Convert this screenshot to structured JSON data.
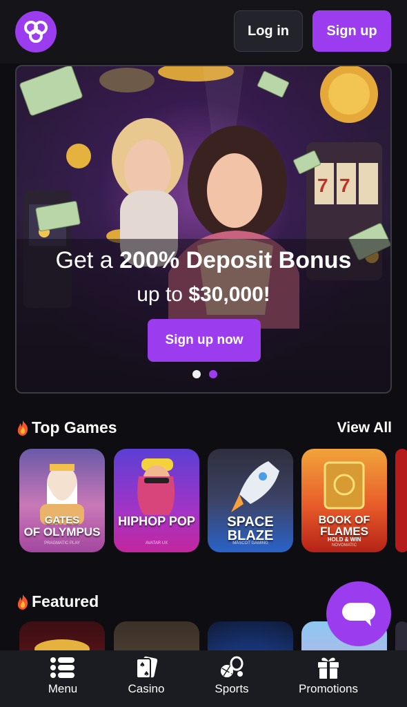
{
  "header": {
    "login_label": "Log in",
    "signup_label": "Sign up"
  },
  "hero": {
    "line1_prefix": "Get a ",
    "line1_bold": "200% Deposit Bonus",
    "line2_prefix": "up to ",
    "line2_bold": "$30,000!",
    "cta_label": "Sign up now",
    "slide_count": 2,
    "active_slide": 2
  },
  "top_games": {
    "title": "Top Games",
    "view_all_label": "View All",
    "games": [
      {
        "name": "GATES",
        "name2": "OF OLYMPUS",
        "provider": "PRAGMATIC PLAY"
      },
      {
        "name": "HIPHOP POP",
        "provider": "AVATAR UX"
      },
      {
        "name": "SPACE BLAZE",
        "provider": "MASCOT GAMING"
      },
      {
        "name": "BOOK OF",
        "name2": "FLAMES",
        "name3": "HOLD & WIN",
        "provider": "NOVOMATIC"
      }
    ]
  },
  "featured": {
    "title": "Featured"
  },
  "bottom_nav": {
    "items": [
      {
        "label": "Menu",
        "icon": "menu-icon"
      },
      {
        "label": "Casino",
        "icon": "cards-icon"
      },
      {
        "label": "Sports",
        "icon": "sports-icon"
      },
      {
        "label": "Promotions",
        "icon": "gift-icon"
      }
    ]
  },
  "colors": {
    "accent": "#9b3dee",
    "background": "#0d0d12",
    "header": "#141419",
    "nav": "#1b1c22"
  }
}
